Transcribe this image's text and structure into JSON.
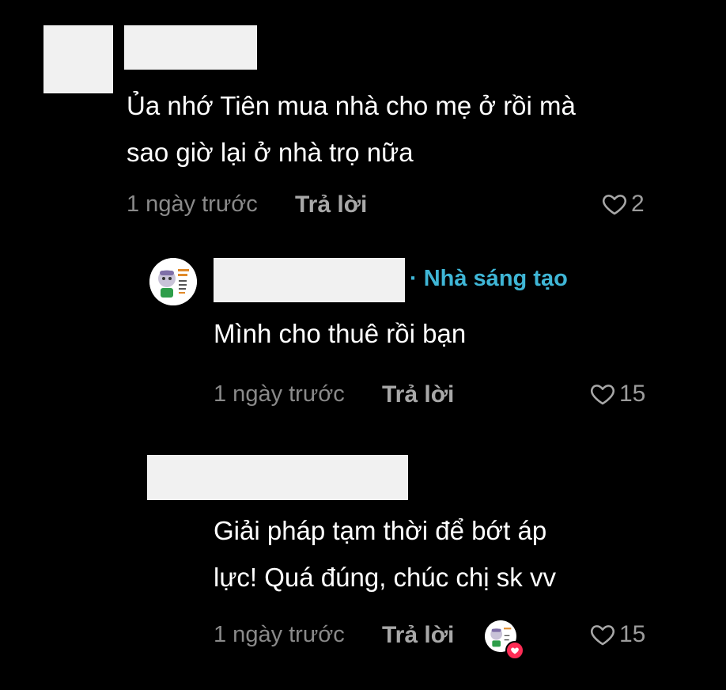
{
  "comments": [
    {
      "text_lines": [
        "Ủa nhớ Tiên mua nhà cho mẹ ở rồi mà",
        "sao giờ lại ở nhà trọ nữa"
      ],
      "time": "1 ngày trước",
      "reply_label": "Trả lời",
      "likes": "2"
    },
    {
      "badge": "· Nhà sáng tạo",
      "text_lines": [
        "Mình cho thuê rồi bạn"
      ],
      "time": "1 ngày trước",
      "reply_label": "Trả lời",
      "likes": "15"
    },
    {
      "text_lines": [
        "Giải pháp tạm thời để bớt áp",
        "lực! Quá đúng, chúc chị sk vv"
      ],
      "time": "1 ngày trước",
      "reply_label": "Trả lời",
      "likes": "15"
    }
  ],
  "colors": {
    "background": "#000000",
    "text": "#ffffff",
    "meta": "#8a8a8a",
    "creator_badge": "#3fb6d6",
    "heart_badge": "#fe2c55"
  }
}
